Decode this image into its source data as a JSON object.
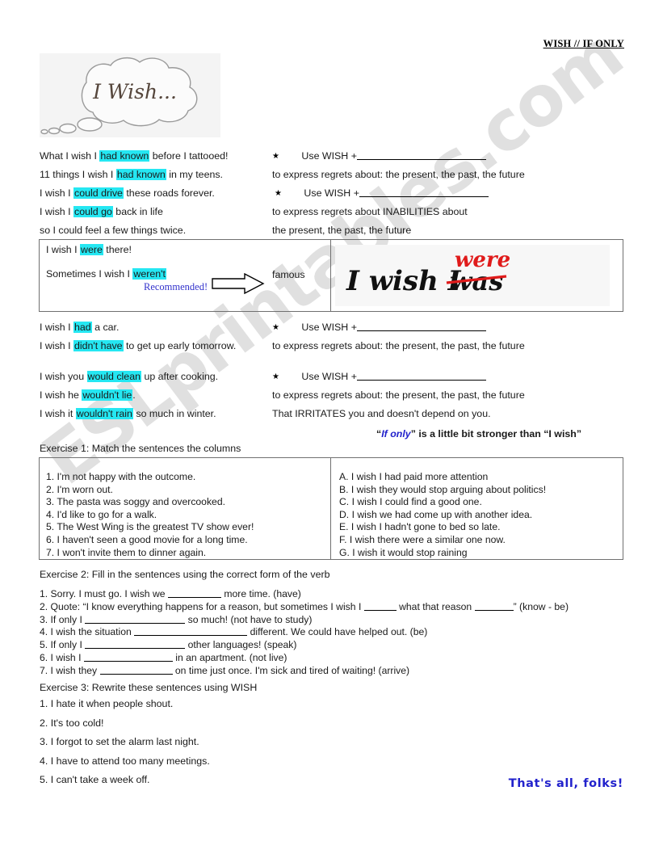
{
  "header": {
    "title": "WISH // IF ONLY"
  },
  "bubble": {
    "text": "I Wish...",
    "alt": "thought-bubble-i-wish"
  },
  "section1": {
    "examples": [
      {
        "pre": "What I wish I ",
        "hl": "had known",
        "post": " before I tattooed!"
      },
      {
        "pre": "11 things I wish I ",
        "hl": "had known",
        "post": " in my teens."
      },
      {
        "pre": "I wish I ",
        "hl": "could drive",
        "post": " these roads forever."
      },
      {
        "pre": "I wish I ",
        "hl": "could go",
        "post": " back in life"
      },
      {
        "pre": "so I could feel a few things twice.",
        "hl": "",
        "post": ""
      }
    ],
    "rules": [
      {
        "star": "★",
        "label": "Use WISH +",
        "note": "to express regrets about: the present,  the  past,   the future"
      },
      {
        "star": "★",
        "label": "Use WISH +",
        "note": "to express regrets about INABILITIES about",
        "note2": "the present,  the  past,   the future"
      }
    ]
  },
  "were_box": {
    "line1_pre": "I wish I ",
    "line1_hl": "were",
    "line1_post": " there!",
    "line2_pre": "Sometimes I wish I ",
    "line2_hl": "weren't",
    "recommended": "Recommended!",
    "famous": "famous",
    "handwriting": {
      "base": "I wish I",
      "struck": "was",
      "correction": "were"
    }
  },
  "section2": {
    "examples": [
      {
        "pre": "I wish I ",
        "hl": "had",
        "post": " a car."
      },
      {
        "pre": "I wish I ",
        "hl": "didn't have",
        "post": " to get up early tomorrow."
      }
    ],
    "rule": {
      "star": "★",
      "label": "Use WISH +",
      "note": "to express regrets about: the present,  the  past,   the future"
    }
  },
  "section3": {
    "examples": [
      {
        "pre": "I wish you ",
        "hl": "would clean",
        "post": " up after cooking."
      },
      {
        "pre": "I wish he ",
        "hl": "wouldn't lie",
        "post": "."
      },
      {
        "pre": "I wish it ",
        "hl": "wouldn't rain",
        "post": " so much in winter."
      }
    ],
    "rule": {
      "star": "★",
      "label": "Use WISH +",
      "note": "to express regrets about: the present,  the  past,   the future",
      "note2": "That IRRITATES you and doesn't depend on you."
    },
    "ifonly_pre": "“",
    "ifonly_em": "If only",
    "ifonly_post": "” is a little bit stronger than “I wish”"
  },
  "exercise1": {
    "heading": "Exercise 1: Match the sentences the columns",
    "left": [
      "1. I'm not happy with the outcome.",
      "2. I'm worn out.",
      "3. The pasta was soggy and overcooked.",
      "4. I'd like to go for a walk.",
      "5. The West Wing is the greatest TV show ever!",
      "6. I haven't seen a good movie for a long time.",
      "7. I won't invite them to dinner again."
    ],
    "right": [
      "A. I wish I had paid more attention",
      "B. I wish they would stop arguing about politics!",
      "C. I wish I could find a good one.",
      "D. I wish we had come up with another idea.",
      "E. I wish I hadn't gone to bed so late.",
      "F.  I wish there were a similar one now.",
      "G. I wish it would stop raining"
    ]
  },
  "exercise2": {
    "heading": "Exercise 2: Fill in the sentences using the correct form of the verb",
    "items": [
      {
        "pre": "1. Sorry. I must go. I wish we ",
        "blank": 66,
        "post": " more time. (have)"
      },
      {
        "pre": "2. Quote: “I know everything happens for a reason, but sometimes I wish I ",
        "blank": 40,
        "mid": " what that reason ",
        "blank2": 48,
        "post": "” (know - be)"
      },
      {
        "pre": "3. If only I ",
        "blank": 124,
        "post": " so much! (not have to study)"
      },
      {
        "pre": "4. I wish the situation ",
        "blank": 140,
        "post": " different. We could have helped out. (be)"
      },
      {
        "pre": "5. If only I ",
        "blank": 124,
        "post": " other languages! (speak)"
      },
      {
        "pre": "6. I wish I ",
        "blank": 110,
        "post": " in an apartment. (not live)"
      },
      {
        "pre": "7. I wish they ",
        "blank": 90,
        "post": " on time just once. I'm sick and tired of waiting! (arrive)"
      }
    ]
  },
  "exercise3": {
    "heading": "Exercise 3: Rewrite these sentences using WISH",
    "items": [
      "1. I hate it when people shout.",
      "2. It's too cold!",
      "3. I forgot to set the alarm last night.",
      "4. I have to attend too many meetings.",
      "5. I can't take a week off."
    ]
  },
  "closing": {
    "text": "That's all,  folks!"
  },
  "watermark": {
    "text": "ESLprintables.com"
  },
  "colors": {
    "highlight": "#25e7f2",
    "accent_blue": "#2222cc",
    "recommended_blue": "#3333cc",
    "correction_red": "#e01b1b",
    "border_gray": "#707070"
  }
}
